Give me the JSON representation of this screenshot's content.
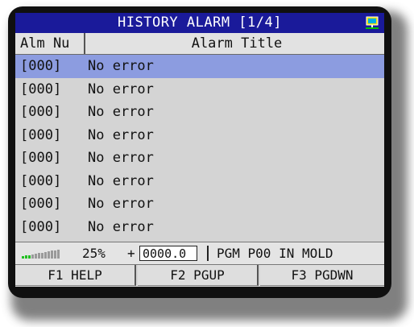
{
  "header": {
    "title": "HISTORY ALARM [1/4]",
    "icon": "network-icon"
  },
  "table": {
    "columns": [
      "Alm Nu",
      "Alarm Title"
    ],
    "rows": [
      {
        "num": "[000]",
        "title": "No error"
      },
      {
        "num": "[000]",
        "title": "No error"
      },
      {
        "num": "[000]",
        "title": "No error"
      },
      {
        "num": "[000]",
        "title": "No error"
      },
      {
        "num": "[000]",
        "title": "No error"
      },
      {
        "num": "[000]",
        "title": "No error"
      },
      {
        "num": "[000]",
        "title": "No error"
      },
      {
        "num": "[000]",
        "title": "No error"
      }
    ],
    "selected_row": 0
  },
  "status": {
    "signal_level": 0.25,
    "percent": "25%",
    "sign": "+",
    "value": "0000.0",
    "program": "PGM P00 IN MOLD"
  },
  "fkeys": [
    "F1 HELP",
    "F2 PGUP",
    "F3 PGDWN"
  ],
  "colors": {
    "title_bg": "#1a1a9a",
    "selected_row": "#8c9ce0",
    "screen_bg": "#d4d4d4",
    "signal_active": "#22c022"
  }
}
